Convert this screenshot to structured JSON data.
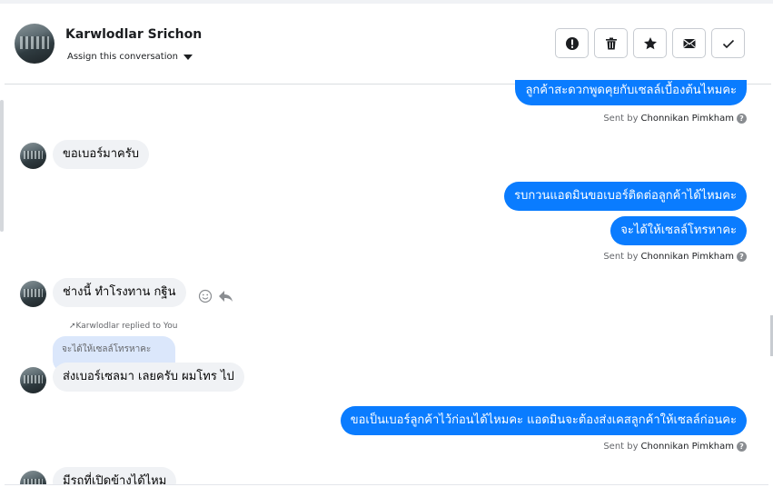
{
  "header": {
    "name": "Karwlodlar Srichon",
    "assign_label": "Assign this conversation",
    "actions": [
      {
        "name": "mark-spam-button",
        "icon": "alert-icon"
      },
      {
        "name": "delete-button",
        "icon": "trash-icon"
      },
      {
        "name": "star-button",
        "icon": "star-icon"
      },
      {
        "name": "mark-unread-button",
        "icon": "envelope-icon"
      },
      {
        "name": "mark-done-button",
        "icon": "check-icon"
      }
    ]
  },
  "messages": {
    "m1": "ลูกค้าสะดวกพูดคุยกับเซลล์เบื้องต้นไหมคะ",
    "m2": "ขอเบอร์มาครับ",
    "m3": "รบกวนแอดมินขอเบอร์ติดต่อลูกค้าได้ไหมคะ",
    "m4": "จะได้ให้เซลล์โทรหาคะ",
    "m5": "ช่างนี้ ทำโรงทาน กฐิน",
    "reply_label": "Karwlodlar replied to You",
    "quoted": "จะได้ให้เซลล์โทรหาคะ",
    "m6": "ส่งเบอร์เซลมา เลยครับ  ผมโทร  ไป",
    "m7": "ขอเป็นเบอร์ลูกค้าไว้ก่อนได้ไหมคะ แอดมินจะต้องส่งเคสลูกค้าให้เซลล์ก่อนคะ",
    "m8": "มีรถที่เปิดข้างได้ไหม"
  },
  "sent_by": {
    "prefix": "Sent by",
    "agent": "Chonnikan Pimkham",
    "help": "?"
  },
  "colors": {
    "outgoing": "#0a7cff",
    "incoming": "#f0f2f5",
    "quote": "#dbe7fb"
  }
}
